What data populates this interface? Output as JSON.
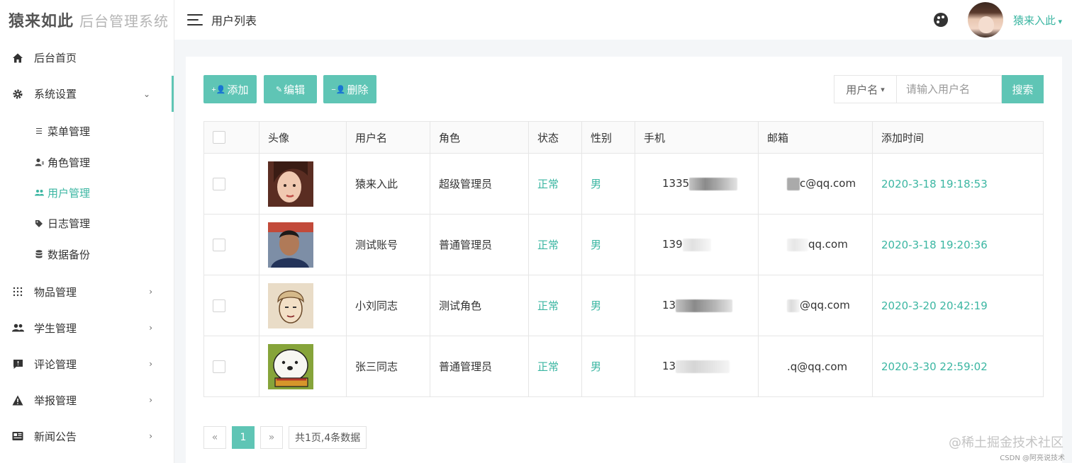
{
  "logo": {
    "main": "猿来如此",
    "sub": "后台管理系统"
  },
  "sidebar": {
    "items": [
      {
        "label": "后台首页",
        "icon": "home-icon"
      },
      {
        "label": "系统设置",
        "icon": "gear-icon",
        "expanded": true
      },
      {
        "label": "物品管理",
        "icon": "grid-dots-icon"
      },
      {
        "label": "学生管理",
        "icon": "users-icon"
      },
      {
        "label": "评论管理",
        "icon": "comment-icon"
      },
      {
        "label": "举报管理",
        "icon": "warning-icon"
      },
      {
        "label": "新闻公告",
        "icon": "news-icon"
      }
    ],
    "submenu": [
      {
        "label": "菜单管理",
        "icon": "list-icon"
      },
      {
        "label": "角色管理",
        "icon": "user-role-icon"
      },
      {
        "label": "用户管理",
        "icon": "users-icon",
        "active": true
      },
      {
        "label": "日志管理",
        "icon": "tag-icon"
      },
      {
        "label": "数据备份",
        "icon": "database-icon"
      }
    ]
  },
  "header": {
    "title": "用户列表",
    "username": "猿来入此"
  },
  "toolbar": {
    "add": "添加",
    "edit": "编辑",
    "delete": "删除"
  },
  "search": {
    "field": "用户名",
    "placeholder": "请输入用户名",
    "button": "搜索"
  },
  "table": {
    "columns": [
      "头像",
      "用户名",
      "角色",
      "状态",
      "性别",
      "手机",
      "邮箱",
      "添加时间"
    ],
    "rows": [
      {
        "username": "猿来入此",
        "role": "超级管理员",
        "status": "正常",
        "gender": "男",
        "phone": "1335",
        "email": "c@qq.com",
        "created": "2020-3-18 19:18:53"
      },
      {
        "username": "测试账号",
        "role": "普通管理员",
        "status": "正常",
        "gender": "男",
        "phone": "139",
        "email": "qq.com",
        "created": "2020-3-18 19:20:36"
      },
      {
        "username": "小刘同志",
        "role": "测试角色",
        "status": "正常",
        "gender": "男",
        "phone": "13",
        "email": "@qq.com",
        "created": "2020-3-20 20:42:19"
      },
      {
        "username": "张三同志",
        "role": "普通管理员",
        "status": "正常",
        "gender": "男",
        "phone": "13",
        "email": ".q@qq.com",
        "created": "2020-3-30 22:59:02"
      }
    ]
  },
  "pager": {
    "prev": "«",
    "current": "1",
    "next": "»",
    "info": "共1页,4条数据"
  },
  "watermark": {
    "main": "@稀土掘金技术社区",
    "sub": "CSDN @阿亮说技术"
  },
  "colors": {
    "accent": "#5fc5b5",
    "accent_text": "#3bb6a2"
  }
}
